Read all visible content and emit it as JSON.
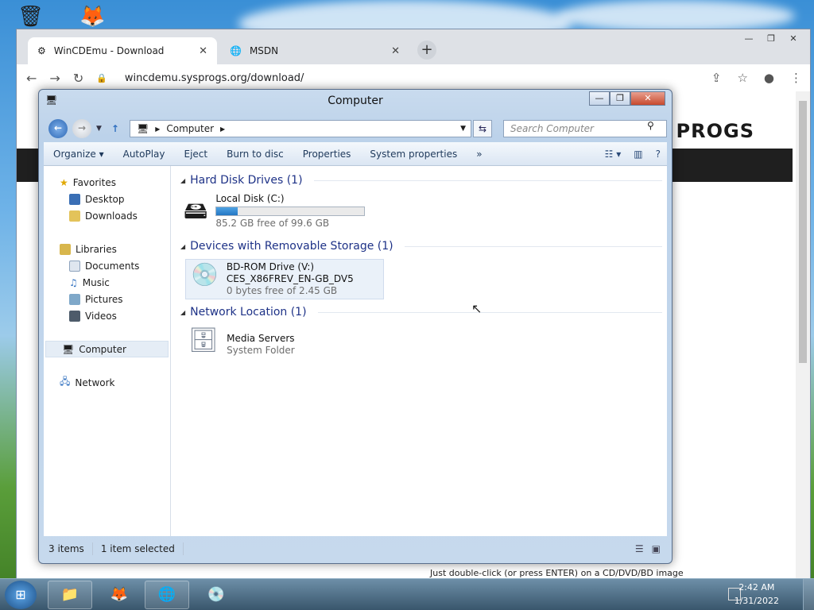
{
  "browser": {
    "tabs": [
      {
        "label": "WinCDEmu - Download",
        "active": true
      },
      {
        "label": "MSDN",
        "active": false
      }
    ],
    "url": "wincdemu.sysprogs.org/download/",
    "logo_text": "PROGS",
    "page_hint": "Just double-click (or press ENTER) on a CD/DVD/BD image"
  },
  "explorer": {
    "title": "Computer",
    "breadcrumb": "Computer",
    "search_placeholder": "Search Computer",
    "commands": [
      "Organize",
      "AutoPlay",
      "Eject",
      "Burn to disc",
      "Properties",
      "System properties"
    ],
    "more_glyph": "»",
    "nav": {
      "favorites": "Favorites",
      "desktop": "Desktop",
      "downloads": "Downloads",
      "libraries": "Libraries",
      "documents": "Documents",
      "music": "Music",
      "pictures": "Pictures",
      "videos": "Videos",
      "computer": "Computer",
      "network": "Network"
    },
    "groups": {
      "hdd": "Hard Disk Drives (1)",
      "removable": "Devices with Removable Storage (1)",
      "network": "Network Location (1)"
    },
    "items": {
      "local_disk": {
        "name": "Local Disk (C:)",
        "free": "85.2 GB free of 99.6 GB",
        "used_fraction": 0.145
      },
      "bdrom": {
        "name": "BD-ROM Drive (V:)",
        "label": "CES_X86FREV_EN-GB_DV5",
        "free": "0 bytes free of 2.45 GB"
      },
      "media": {
        "name": "Media Servers",
        "type": "System Folder"
      }
    },
    "status": {
      "count": "3 items",
      "selection": "1 item selected"
    }
  },
  "taskbar": {
    "time": "2:42 AM",
    "date": "1/31/2022"
  },
  "colors": {
    "group_heading": "#1e3287",
    "progress": "#2477c3",
    "accent": "#5a6f8c"
  }
}
